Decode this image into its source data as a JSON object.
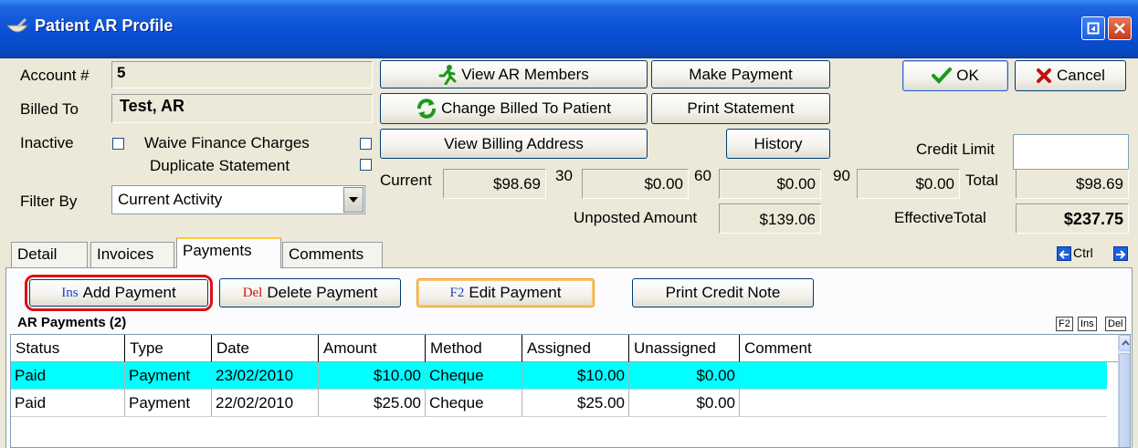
{
  "window": {
    "title": "Patient AR Profile"
  },
  "account": {
    "label": "Account #",
    "value": "5"
  },
  "billed_to": {
    "label": "Billed To",
    "value": "Test, AR"
  },
  "inactive": {
    "label": "Inactive",
    "checked": false
  },
  "waive_finance": {
    "label": "Waive Finance Charges",
    "checked": false
  },
  "duplicate_statement": {
    "label": "Duplicate Statement",
    "checked": false
  },
  "filter": {
    "label": "Filter By",
    "value": "Current Activity"
  },
  "buttons": {
    "view_ar_members": "View AR Members",
    "change_billed_to": "Change Billed To Patient",
    "view_billing_address": "View Billing Address",
    "make_payment": "Make Payment",
    "print_statement": "Print Statement",
    "history": "History",
    "ok": "OK",
    "cancel": "Cancel"
  },
  "credit_limit": {
    "label": "Credit Limit",
    "value": ""
  },
  "aging": {
    "current_label": "Current",
    "current": "$98.69",
    "d30_label": "30",
    "d30": "$0.00",
    "d60_label": "60",
    "d60": "$0.00",
    "d90_label": "90",
    "d90": "$0.00",
    "total_label": "Total",
    "total": "$98.69",
    "unposted_label": "Unposted Amount",
    "unposted": "$139.06",
    "effective_label": "EffectiveTotal",
    "effective": "$237.75"
  },
  "tabs": [
    {
      "label": "Detail",
      "active": false
    },
    {
      "label": "Invoices",
      "active": false
    },
    {
      "label": "Payments",
      "active": true
    },
    {
      "label": "Comments",
      "active": false
    }
  ],
  "tab_nav": {
    "label": "Ctrl"
  },
  "payments_toolbar": {
    "add_key": "Ins",
    "add_label": "Add Payment",
    "delete_key": "Del",
    "delete_label": "Delete Payment",
    "edit_key": "F2",
    "edit_label": "Edit Payment",
    "print_credit_label": "Print Credit Note"
  },
  "grid_title": "AR Payments (2)",
  "mini_keys": [
    "F2",
    "Ins",
    "Del"
  ],
  "grid": {
    "columns": [
      "Status",
      "Type",
      "Date",
      "Amount",
      "Method",
      "Assigned",
      "Unassigned",
      "Comment"
    ],
    "rows": [
      {
        "status": "Paid",
        "type": "Payment",
        "date": "23/02/2010",
        "amount": "$10.00",
        "method": "Cheque",
        "assigned": "$10.00",
        "unassigned": "$0.00",
        "comment": "",
        "selected": true
      },
      {
        "status": "Paid",
        "type": "Payment",
        "date": "22/02/2010",
        "amount": "$25.00",
        "method": "Cheque",
        "assigned": "$25.00",
        "unassigned": "$0.00",
        "comment": "",
        "selected": false
      }
    ]
  },
  "colors": {
    "selected_row": "#00ffff",
    "title_bar": "#0a52d8",
    "highlight_ring": "#e01010"
  }
}
